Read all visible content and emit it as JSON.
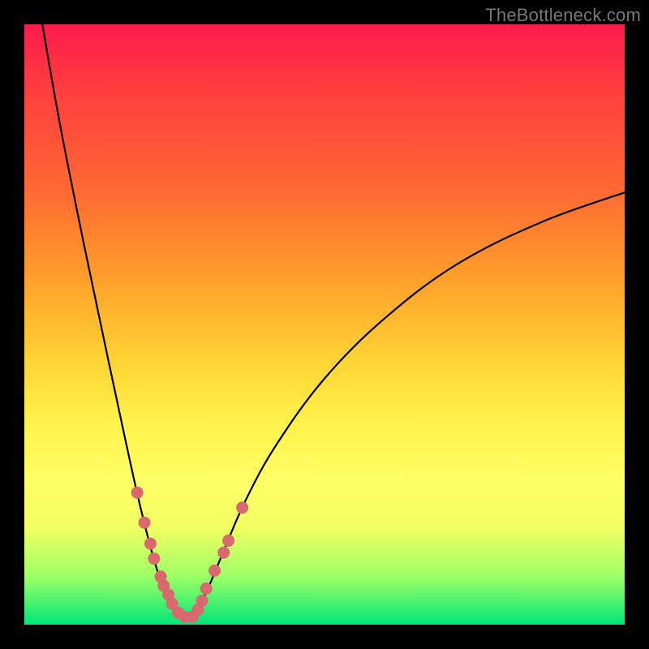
{
  "watermark": "TheBottleneck.com",
  "colors": {
    "frame": "#000000",
    "gradient_top": "#ff1a4d",
    "gradient_bottom": "#00e676",
    "curve": "#000000",
    "dot": "#d86a6f"
  },
  "chart_data": {
    "type": "line",
    "title": "",
    "xlabel": "",
    "ylabel": "",
    "xlim": [
      0,
      100
    ],
    "ylim": [
      0,
      100
    ],
    "note": "Bottleneck-style chart: two curves descending from top and meeting near the bottom forming a V. Salmon dots mark sample points near the valley. Values estimated from pixels (no axis ticks present).",
    "series": [
      {
        "name": "left-curve",
        "x": [
          3,
          6,
          10,
          14,
          17,
          19,
          21,
          22.5,
          24,
          25.5,
          27
        ],
        "y": [
          100,
          83,
          63,
          44,
          30,
          21,
          13,
          8,
          5,
          2.5,
          1
        ]
      },
      {
        "name": "right-curve",
        "x": [
          27,
          29,
          31,
          33.5,
          37,
          42,
          50,
          60,
          72,
          86,
          100
        ],
        "y": [
          1,
          3,
          7,
          13,
          21,
          30,
          41,
          51,
          60,
          67,
          72
        ]
      }
    ],
    "points": {
      "name": "sample-dots",
      "x": [
        18.8,
        20.0,
        21.0,
        21.6,
        22.7,
        23.2,
        24.0,
        24.6,
        25.6,
        26.8,
        28.0,
        28.9,
        29.6,
        30.3,
        31.7,
        33.2,
        34.0,
        36.3
      ],
      "y": [
        22.0,
        17.0,
        13.5,
        11.0,
        8.0,
        6.5,
        5.0,
        3.5,
        2.0,
        1.3,
        1.3,
        2.5,
        4.0,
        6.0,
        9.0,
        12.0,
        14.0,
        19.5
      ]
    }
  }
}
